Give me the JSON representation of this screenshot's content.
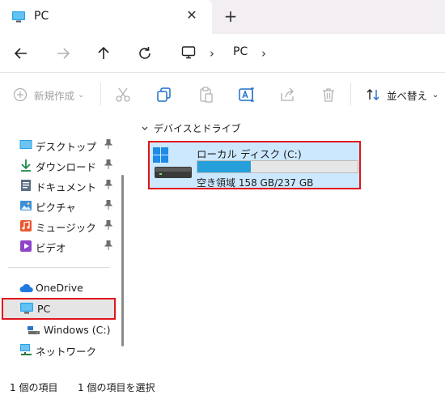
{
  "tab": {
    "title": "PC",
    "close": "✕",
    "new_tab": "+"
  },
  "nav": {
    "breadcrumb": "PC",
    "sep1": "›",
    "sep2": "›"
  },
  "toolbar": {
    "new_label": "新規作成",
    "new_caret": "⌄",
    "sort_label": "並べ替え",
    "sort_caret": "⌄"
  },
  "sidebar": {
    "quick_items": [
      {
        "label": "デスクトップ",
        "icon": "desktop-icon",
        "pinned": true
      },
      {
        "label": "ダウンロード",
        "icon": "download-icon",
        "pinned": true
      },
      {
        "label": "ドキュメント",
        "icon": "documents-icon",
        "pinned": true
      },
      {
        "label": "ピクチャ",
        "icon": "pictures-icon",
        "pinned": true
      },
      {
        "label": "ミュージック",
        "icon": "music-icon",
        "pinned": true
      },
      {
        "label": "ビデオ",
        "icon": "videos-icon",
        "pinned": true
      }
    ],
    "onedrive": "OneDrive",
    "pc": "PC",
    "windows_c": "Windows (C:)",
    "network": "ネットワーク",
    "pin_glyph": "📌"
  },
  "content": {
    "group_header": "デバイスとドライブ",
    "drive": {
      "name": "ローカル ディスク (C:)",
      "space_text": "空き領域 158 GB/237 GB",
      "free_gb": 158,
      "total_gb": 237
    }
  },
  "status": {
    "count": "1 個の項目",
    "selected": "1 個の項目を選択"
  },
  "colors": {
    "accent": "#26a0da",
    "highlight": "#cce8ff",
    "annotation": "#e0141c"
  }
}
